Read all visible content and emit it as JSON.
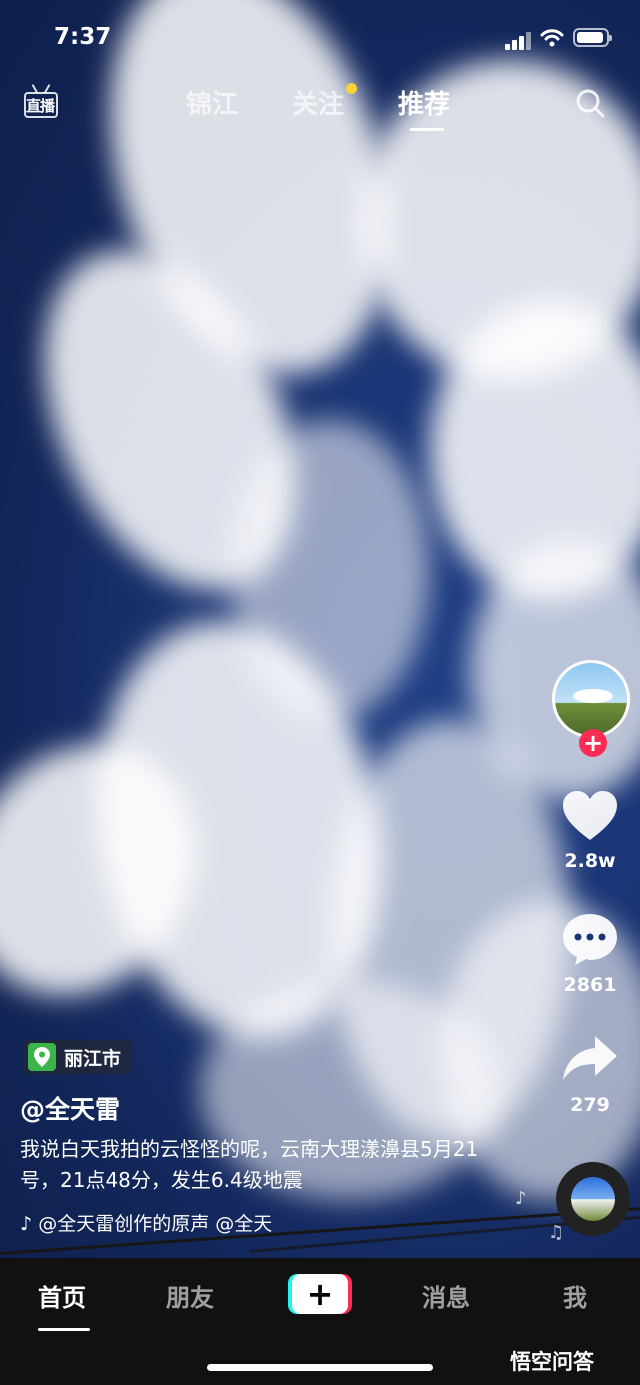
{
  "status_bar": {
    "time": "7:37"
  },
  "top_nav": {
    "live_label": "直播",
    "tabs": [
      {
        "label": "锦江",
        "active": false
      },
      {
        "label": "关注",
        "active": false,
        "has_dot": true
      },
      {
        "label": "推荐",
        "active": true
      }
    ],
    "search_icon": "search-icon"
  },
  "rail": {
    "likes": "2.8w",
    "comments": "2861",
    "shares": "279",
    "icons": [
      "heart-icon",
      "comment-icon",
      "share-icon",
      "plus-icon"
    ]
  },
  "caption": {
    "location": "丽江市",
    "author": "@全天雷",
    "description": "我说白天我拍的云怪怪的呢，云南大理漾濞县5月21号，21点48分，发生6.4级地震",
    "music": "@全天雷创作的原声    @全天"
  },
  "bottom_nav": {
    "tabs": [
      {
        "label": "首页",
        "active": true
      },
      {
        "label": "朋友",
        "active": false
      },
      {
        "label": "消息",
        "active": false
      },
      {
        "label": "我",
        "active": false
      }
    ],
    "create_label": "+"
  },
  "watermark": "悟空问答",
  "colors": {
    "accent_red": "#fe2c55",
    "accent_cyan": "#25f4ee",
    "location_green": "#3bb54a",
    "notification_dot": "#f8d33a",
    "sky": "#1b3575"
  }
}
